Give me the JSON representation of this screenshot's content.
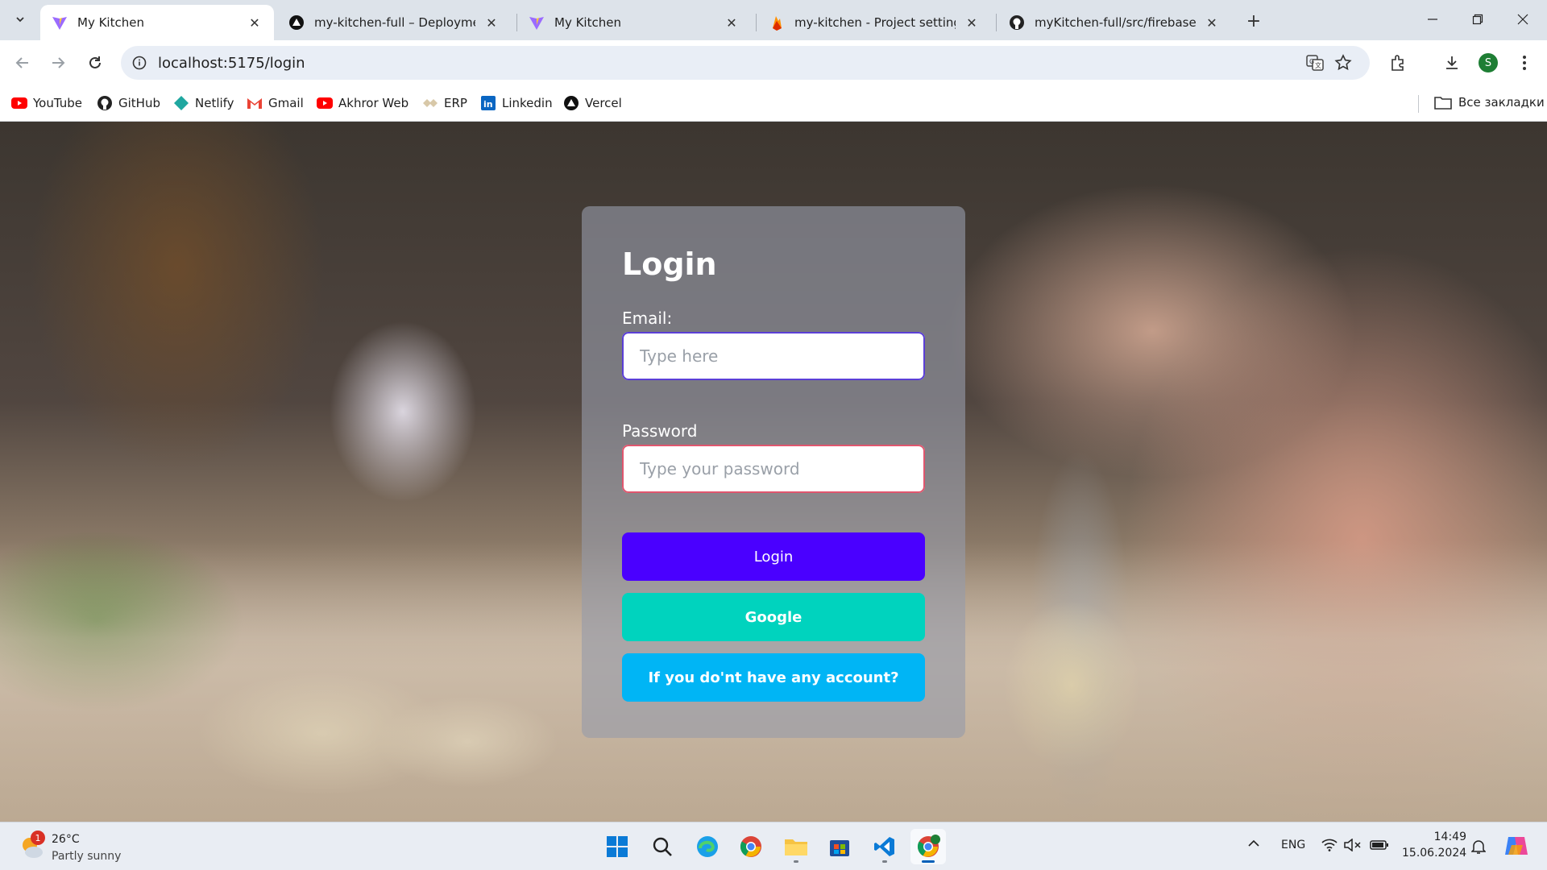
{
  "browser": {
    "tabs": [
      {
        "title": "My Kitchen",
        "icon": "vite-icon",
        "active": true
      },
      {
        "title": "my-kitchen-full – Deployment C",
        "icon": "vercel-icon",
        "active": false
      },
      {
        "title": "My Kitchen",
        "icon": "vite-icon",
        "active": false
      },
      {
        "title": "my-kitchen - Project settings - (",
        "icon": "firebase-icon",
        "active": false
      },
      {
        "title": "myKitchen-full/src/firebase/fire",
        "icon": "github-icon",
        "active": false
      }
    ],
    "url": "localhost:5175/login",
    "profile_initial": "S",
    "bookmarks": [
      {
        "label": "YouTube",
        "icon": "youtube-icon"
      },
      {
        "label": "GitHub",
        "icon": "github-icon"
      },
      {
        "label": "Netlify",
        "icon": "netlify-icon"
      },
      {
        "label": "Gmail",
        "icon": "gmail-icon"
      },
      {
        "label": "Akhror Web",
        "icon": "youtube-icon"
      },
      {
        "label": "ERP",
        "icon": "erp-icon"
      },
      {
        "label": "Linkedin",
        "icon": "linkedin-icon"
      },
      {
        "label": "Vercel",
        "icon": "vercel-icon"
      }
    ],
    "all_bookmarks_label": "Все закладки"
  },
  "login": {
    "title": "Login",
    "email_label": "Email:",
    "email_placeholder": "Type here",
    "password_label": "Password",
    "password_placeholder": "Type your password",
    "login_button": "Login",
    "google_button": "Google",
    "register_button": "If you do'nt have any account?"
  },
  "colors": {
    "login_button": "#4a00ff",
    "google_button": "#00d3be",
    "register_button": "#00b5f5"
  },
  "taskbar": {
    "weather_temp": "26°C",
    "weather_desc": "Partly sunny",
    "weather_badge": "1",
    "language": "ENG",
    "time": "14:49",
    "date": "15.06.2024",
    "apps": [
      "windows-start-icon",
      "search-icon",
      "edge-icon",
      "chrome-icon",
      "file-explorer-icon",
      "store-icon",
      "vscode-icon",
      "chrome-profile-icon"
    ]
  }
}
